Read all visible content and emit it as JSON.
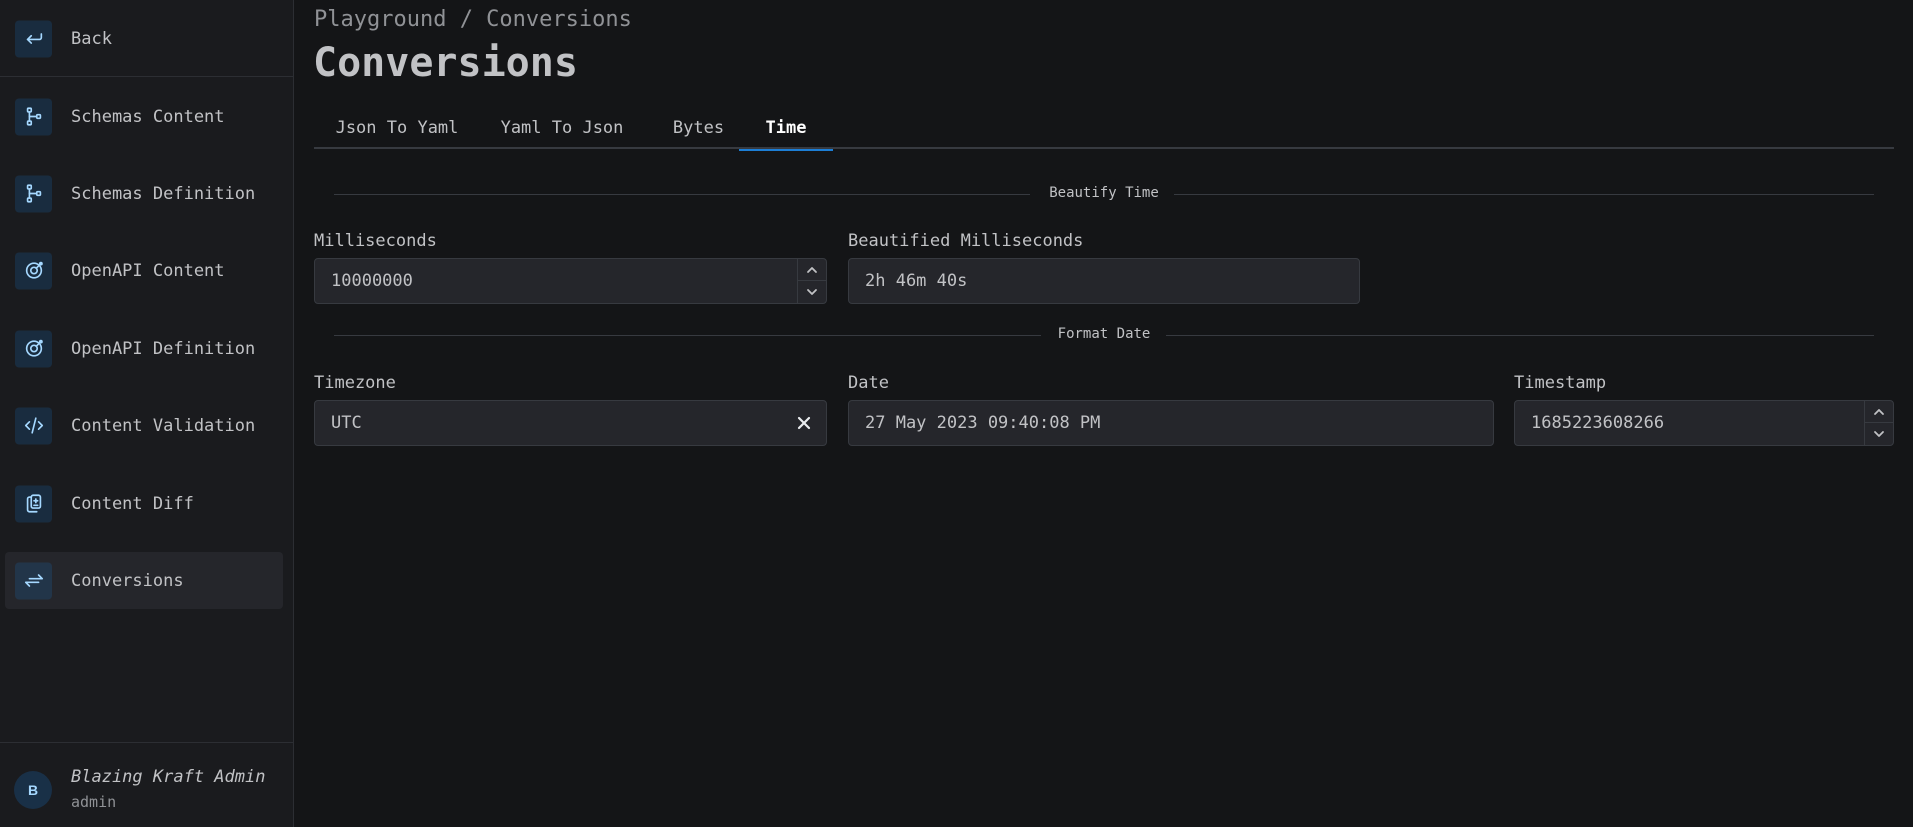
{
  "sidebar": {
    "back_label": "Back",
    "items": [
      {
        "label": "Schemas Content",
        "icon": "schema-icon"
      },
      {
        "label": "Schemas Definition",
        "icon": "schema-icon"
      },
      {
        "label": "OpenAPI Content",
        "icon": "openapi-icon"
      },
      {
        "label": "OpenAPI Definition",
        "icon": "openapi-icon"
      },
      {
        "label": "Content Validation",
        "icon": "code-icon"
      },
      {
        "label": "Content Diff",
        "icon": "file-diff-icon"
      },
      {
        "label": "Conversions",
        "icon": "arrows-exchange-icon",
        "active": true
      }
    ],
    "user": {
      "initial": "B",
      "name": "Blazing Kraft Admin",
      "role": "admin"
    }
  },
  "header": {
    "breadcrumb": "Playground / Conversions",
    "title": "Conversions"
  },
  "tabs": [
    {
      "label": "Json To Yaml"
    },
    {
      "label": "Yaml To Json"
    },
    {
      "label": "Bytes"
    },
    {
      "label": "Time",
      "active": true
    }
  ],
  "beautify": {
    "section_label": "Beautify Time",
    "milliseconds_label": "Milliseconds",
    "milliseconds_value": "10000000",
    "beautified_label": "Beautified Milliseconds",
    "beautified_value": "2h 46m 40s"
  },
  "format_date": {
    "section_label": "Format Date",
    "timezone_label": "Timezone",
    "timezone_value": "UTC",
    "date_label": "Date",
    "date_value": "27 May 2023 09:40:08 PM",
    "timestamp_label": "Timestamp",
    "timestamp_value": "1685223608266"
  },
  "colors": {
    "background": "#141517",
    "sidebar": "#1a1b1e",
    "accent": "#1c7ed6",
    "icon": "#a5d8ff"
  }
}
